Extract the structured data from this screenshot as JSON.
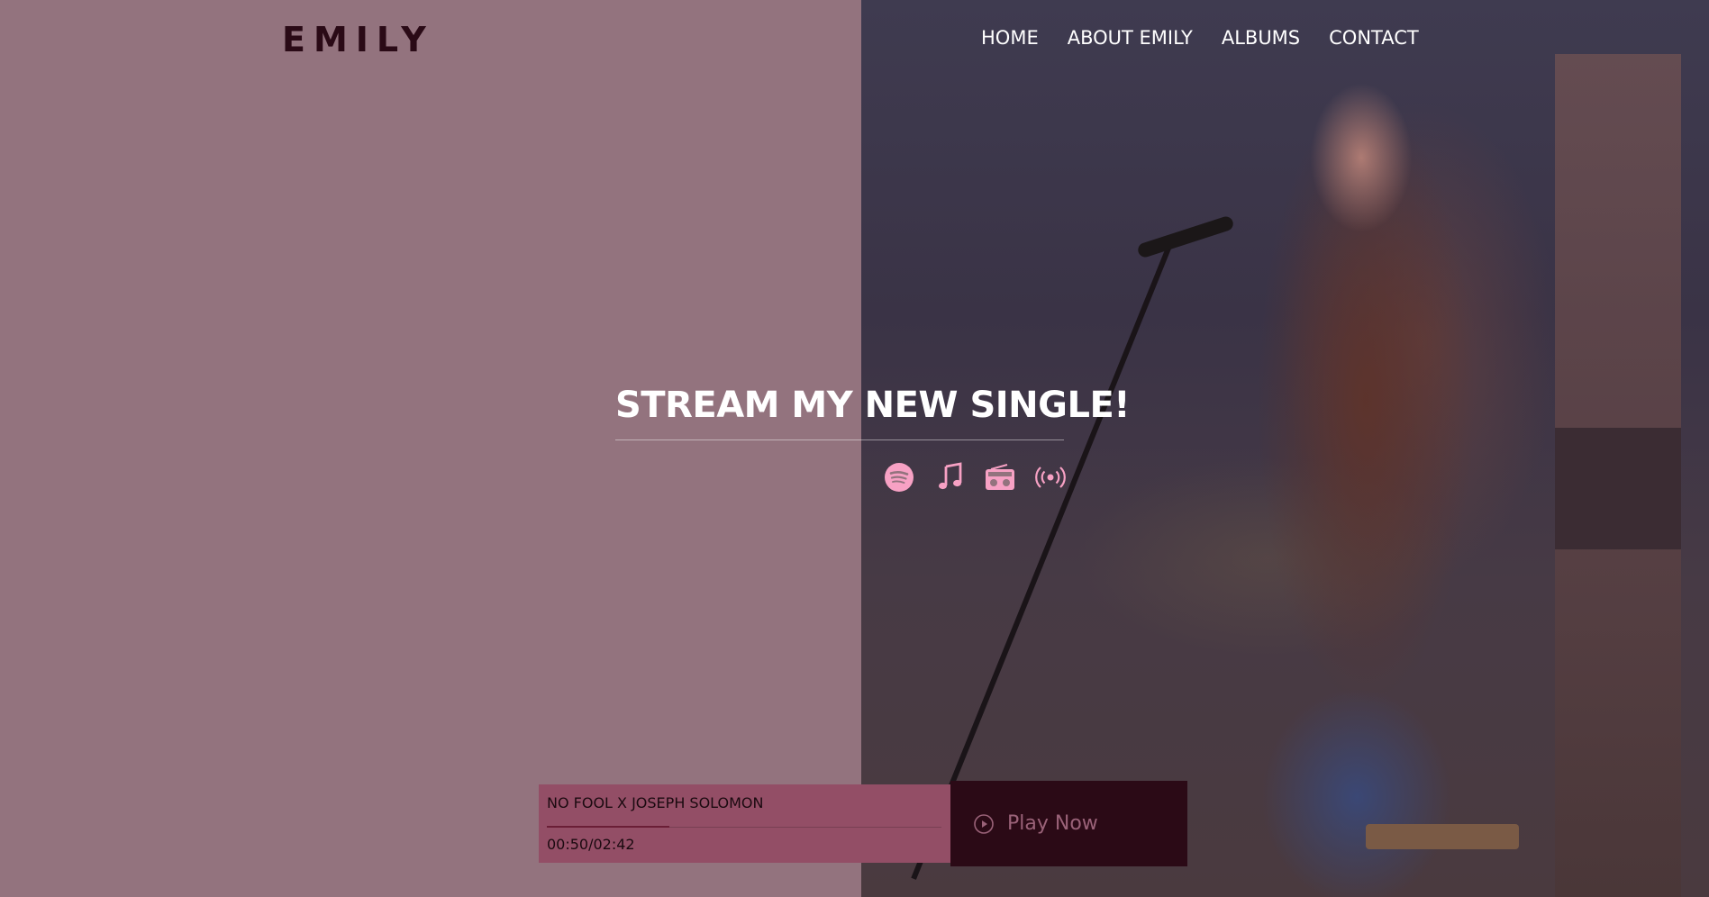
{
  "brand": {
    "logo_text": "EMILY"
  },
  "nav": {
    "items": [
      {
        "label": "HOME"
      },
      {
        "label": "ABOUT EMILY"
      },
      {
        "label": "ALBUMS"
      },
      {
        "label": "CONTACT"
      }
    ]
  },
  "hero": {
    "title": "STREAM MY NEW SINGLE!",
    "stream_icons": [
      "spotify-icon",
      "music-note-icon",
      "radio-icon",
      "podcast-icon"
    ]
  },
  "player": {
    "track_title": "NO FOOL X JOSEPH SOLOMON",
    "time": "00:50/02:42",
    "progress": 0.31,
    "play_label": "Play Now",
    "play_icon": "play-circle-icon"
  },
  "colors": {
    "left_panel": "#93737e",
    "logo": "#2a0a16",
    "icon_accent": "#f7a1c4",
    "player_bg": "#934e66",
    "play_button_bg": "#2b0a16",
    "play_text": "#9a6278"
  }
}
